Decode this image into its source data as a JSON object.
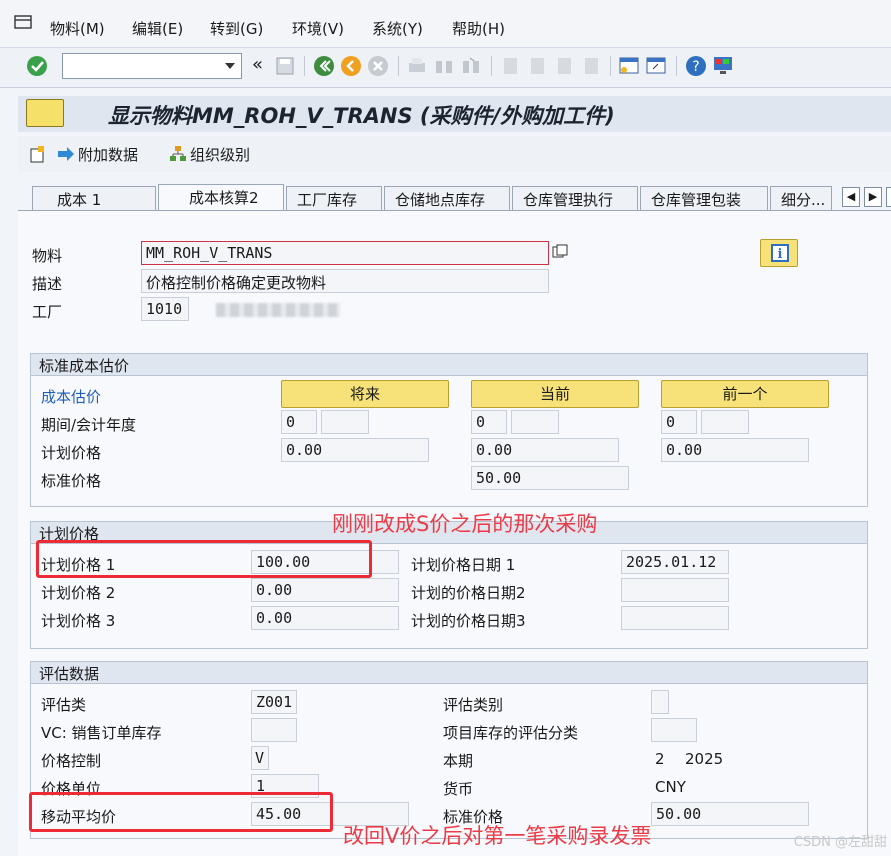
{
  "menu": {
    "items": [
      "物料(M)",
      "编辑(E)",
      "转到(G)",
      "环境(V)",
      "系统(Y)",
      "帮助(H)"
    ]
  },
  "toolbar": {
    "command_value": "",
    "icons": [
      "enter-icon",
      "back-icon",
      "exit-icon",
      "cancel-icon",
      "print-icon",
      "find-icon",
      "find-next-icon",
      "first-page-icon",
      "prev-page-icon",
      "next-page-icon",
      "last-page-icon",
      "new-session-icon",
      "shortcut-icon",
      "help-icon",
      "customize-icon"
    ]
  },
  "title": "显示物料MM_ROH_V_TRANS (采购件/外购加工件)",
  "app_toolbar": {
    "additional_data": "附加数据",
    "org_levels": "组织级别"
  },
  "tabs": [
    "成本 1",
    "成本核算2",
    "工厂库存",
    "仓储地点库存",
    "仓库管理执行",
    "仓库管理包装",
    "细分..."
  ],
  "active_tab": "成本核算2",
  "header": {
    "material_label": "物料",
    "material_value": "MM_ROH_V_TRANS",
    "desc_label": "描述",
    "desc_value": "价格控制价格确定更改物料",
    "plant_label": "工厂",
    "plant_value": "1010"
  },
  "std_cost": {
    "title": "标准成本估价",
    "cost_est_label": "成本估价",
    "buttons": [
      "将来",
      "当前",
      "前一个"
    ],
    "period_label": "期间/会计年度",
    "period_values": [
      "0",
      "0",
      "0"
    ],
    "planned_price_label": "计划价格",
    "planned_values": [
      "0.00",
      "0.00",
      "0.00"
    ],
    "std_price_label": "标准价格",
    "std_price_value": "50.00"
  },
  "planned": {
    "title": "计划价格",
    "rows": [
      {
        "label": "计划价格 1",
        "value": "100.00",
        "date_label": "计划价格日期 1",
        "date": "2025.01.12"
      },
      {
        "label": "计划价格 2",
        "value": "0.00",
        "date_label": "计划的价格日期2",
        "date": ""
      },
      {
        "label": "计划价格 3",
        "value": "0.00",
        "date_label": "计划的价格日期3",
        "date": ""
      }
    ]
  },
  "valuation": {
    "title": "评估数据",
    "val_class_label": "评估类",
    "val_class_value": "Z001",
    "val_category_label": "评估类别",
    "val_category_value": "",
    "vc_label": "VC: 销售订单库存",
    "vc_value": "",
    "proj_label": "项目库存的评估分类",
    "proj_value": "",
    "price_ctrl_label": "价格控制",
    "price_ctrl_value": "V",
    "period_label": "本期",
    "period_value": "2",
    "year_value": "2025",
    "price_unit_label": "价格单位",
    "price_unit_value": "1",
    "currency_label": "货币",
    "currency_value": "CNY",
    "mavg_label": "移动平均价",
    "mavg_value": "45.00",
    "std_price_label": "标准价格",
    "std_price_value": "50.00"
  },
  "annotations": {
    "top": "刚刚改成S价之后的那次采购",
    "bottom": "改回V价之后对第一笔采购录发票"
  },
  "watermark": "CSDN @左甜甜",
  "colors": {
    "annotation_red": "#ec2b37",
    "button_yellow": "#f7e27a",
    "link_blue": "#1f5fb8"
  }
}
